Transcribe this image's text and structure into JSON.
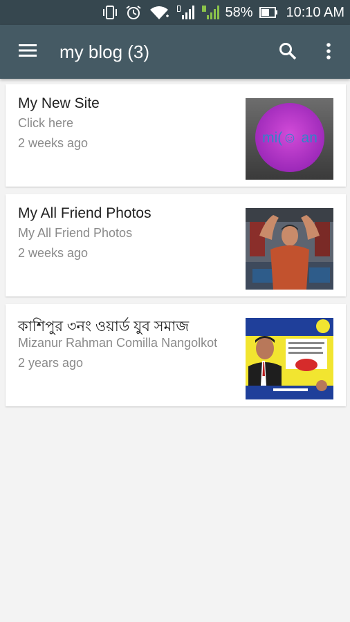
{
  "status_bar": {
    "battery_percent": "58%",
    "time": "10:10 AM",
    "icons": [
      "vibrate-icon",
      "alarm-icon",
      "wifi-icon",
      "signal-icon",
      "signal-2-icon",
      "battery-icon"
    ],
    "accent_color": "#8bc34a"
  },
  "app_bar": {
    "title": "my blog (3)",
    "icons": [
      "menu-icon",
      "search-icon",
      "overflow-menu-icon"
    ],
    "background": "#455a64"
  },
  "posts": [
    {
      "title": "My New Site",
      "subtitle": "Click here",
      "time": "2 weeks ago",
      "thumbnail_text": "mi(☺ an"
    },
    {
      "title": "My All Friend Photos",
      "subtitle": "My All Friend Photos",
      "time": "2 weeks ago"
    },
    {
      "title": "কাশিপুর ৩নং ওয়ার্ড যুব সমাজ",
      "subtitle": "Mizanur Rahman Comilla Nangolkot",
      "time": "2 years ago"
    }
  ]
}
